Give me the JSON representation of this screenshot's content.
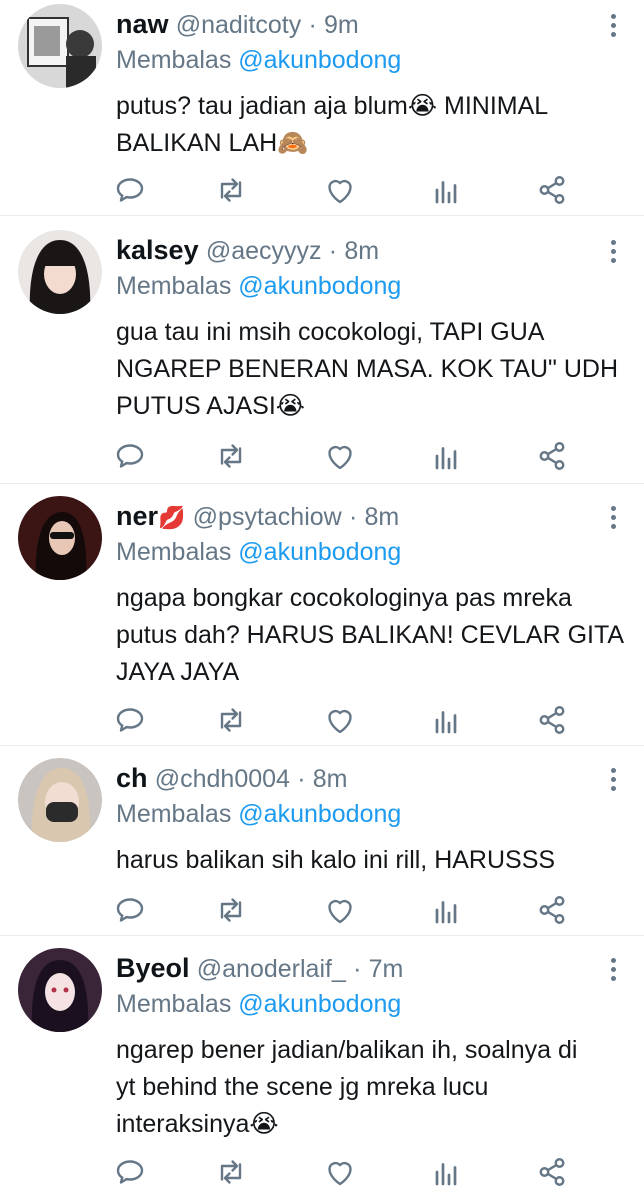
{
  "reply_prefix": "Membalas",
  "reply_to": "@akunbodong",
  "tweets": [
    {
      "name": "naw",
      "handle": "@naditcoty",
      "sep": "·",
      "time": "9m",
      "lines": [
        "putus? tau jadian aja blum😭 MINIMAL",
        "BALIKAN LAH🙈"
      ],
      "name_emoji": ""
    },
    {
      "name": "kalsey",
      "handle": "@aecyyyz",
      "sep": "·",
      "time": "8m",
      "lines": [
        "gua tau ini msih cocokologi, TAPI GUA",
        "NGAREP BENERAN MASA. KOK TAU\" UDH",
        "PUTUS AJASI😭"
      ],
      "name_emoji": ""
    },
    {
      "name": "ner",
      "handle": "@psytachiow",
      "sep": "·",
      "time": "8m",
      "lines": [
        "ngapa bongkar cocokologinya pas mreka",
        "putus dah? HARUS BALIKAN! CEVLAR GITA",
        "JAYA JAYA"
      ],
      "name_emoji": "💋"
    },
    {
      "name": "ch",
      "handle": "@chdh0004",
      "sep": "·",
      "time": "8m",
      "lines": [
        "harus balikan sih kalo ini rill, HARUSSS"
      ],
      "name_emoji": ""
    },
    {
      "name": "Byeol",
      "handle": "@anoderlaif_",
      "sep": "·",
      "time": "7m",
      "lines": [
        "ngarep bener jadian/balikan ih, soalnya di",
        "yt behind the scene jg mreka lucu",
        "interaksinya😭"
      ],
      "name_emoji": ""
    }
  ],
  "icons": {
    "reply": "reply-bubble-icon",
    "retweet": "retweet-icon",
    "like": "heart-icon",
    "analytics": "analytics-bars-icon",
    "share": "share-icon",
    "more": "more-vertical-icon"
  },
  "colors": {
    "name": "#0f1419",
    "secondary": "#657786",
    "mention": "#1d9bf0",
    "divider": "#e6ecf0"
  }
}
